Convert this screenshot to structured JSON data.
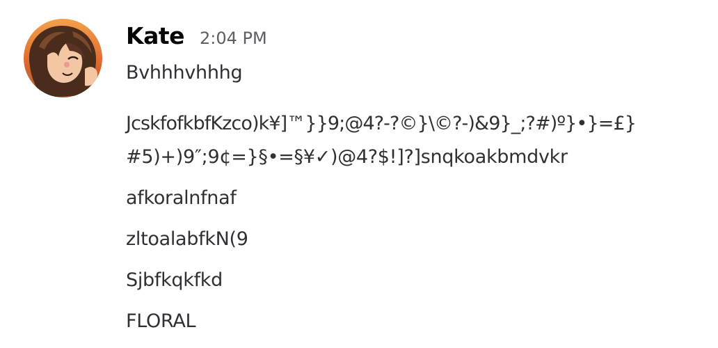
{
  "message": {
    "author": "Kate",
    "timestamp": "2:04 PM",
    "lines": [
      "Bvhhhvhhhg",
      "JcskfofkbfKzco)k¥]™}}9;@4?-?©}\\©?-)&9}_;?#)º}•}=£}",
      "#5)+)9″;9¢=}§•=§¥✓)@4?$!]?]snqkoakbmdvkr",
      "afkoralnfnaf",
      "zltoalabfkN(9",
      "Sjbfkqkfkd",
      "FLORAL"
    ]
  },
  "icons": {
    "avatar": "user-avatar-illustration"
  },
  "colors": {
    "username": "#060607",
    "timestamp": "#5c5e66",
    "text": "#2e3035",
    "background": "#ffffff"
  }
}
